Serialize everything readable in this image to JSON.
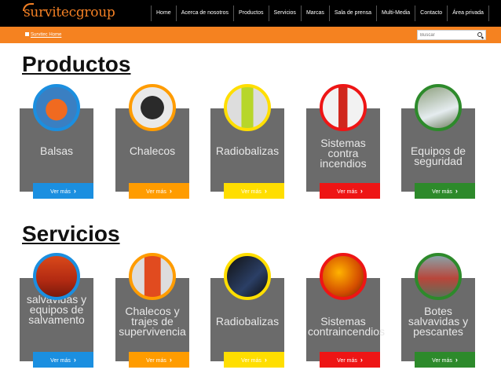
{
  "header": {
    "logo": "survitecgroup",
    "nav": [
      "Home",
      "Acerca de nosotros",
      "Productos",
      "Servicios",
      "Marcas",
      "Sala de prensa",
      "Multi-Media",
      "Contacto",
      "Área privada"
    ]
  },
  "subbar": {
    "breadcrumb": "Survitec Home",
    "search_placeholder": "Buscar"
  },
  "colors": {
    "orange": "#f58220",
    "blue": "#1b8fe0",
    "amber": "#ff9c00",
    "yellow": "#ffde00",
    "red": "#ee1515",
    "green": "#2d8a2b",
    "card": "#6b6b6b"
  },
  "productos": {
    "title": "Productos",
    "items": [
      {
        "label": "Balsas",
        "button": "Ver más",
        "color": "blue",
        "icon": "liferaft-photo"
      },
      {
        "label": "Chalecos",
        "button": "Ver más",
        "color": "amber",
        "icon": "lifejacket-photo"
      },
      {
        "label": "Radiobalizas",
        "button": "Ver más",
        "color": "yellow",
        "icon": "beacon-photo"
      },
      {
        "label": "Sistemas contra incendios",
        "button": "Ver más",
        "color": "red",
        "icon": "extinguisher-photo"
      },
      {
        "label": "Equipos de seguridad",
        "button": "Ver más",
        "color": "green",
        "icon": "safety-equipment-photo"
      }
    ]
  },
  "servicios": {
    "title": "Servicios",
    "items": [
      {
        "label": "Balsas salvavidas y equipos de salvamento",
        "button": "Ver más",
        "color": "blue",
        "icon": "liferaft-service-photo"
      },
      {
        "label": "Chalecos y trajes de supervivencia",
        "button": "Ver más",
        "color": "amber",
        "icon": "survival-suit-photo"
      },
      {
        "label": "Radiobalizas",
        "button": "Ver más",
        "color": "yellow",
        "icon": "beacon-service-photo"
      },
      {
        "label": "Sistemas contraincendios",
        "button": "Ver más",
        "color": "red",
        "icon": "firefighter-photo"
      },
      {
        "label": "Botes salvavidas y pescantes",
        "button": "Ver más",
        "color": "green",
        "icon": "lifeboat-photo"
      }
    ]
  }
}
